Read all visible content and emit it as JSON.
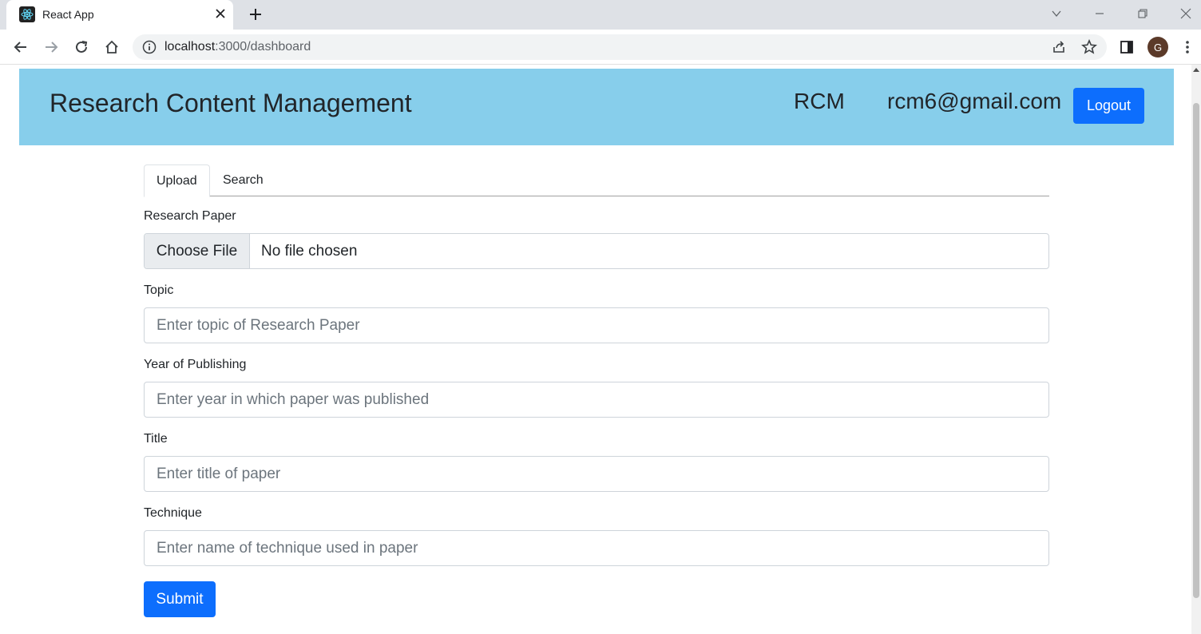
{
  "browser": {
    "tab_title": "React App",
    "url_host": "localhost",
    "url_path": ":3000/dashboard",
    "profile_initial": "G"
  },
  "header": {
    "brand": "Research Content Management",
    "short_name": "RCM",
    "email": "rcm6@gmail.com",
    "logout_label": "Logout",
    "background_color": "#87ceeb"
  },
  "tabs": [
    {
      "label": "Upload",
      "active": true
    },
    {
      "label": "Search",
      "active": false
    }
  ],
  "form": {
    "research_paper": {
      "label": "Research Paper",
      "button_label": "Choose File",
      "status": "No file chosen"
    },
    "topic": {
      "label": "Topic",
      "placeholder": "Enter topic of Research Paper",
      "value": ""
    },
    "year": {
      "label": "Year of Publishing",
      "placeholder": "Enter year in which paper was published",
      "value": ""
    },
    "title": {
      "label": "Title",
      "placeholder": "Enter title of paper",
      "value": ""
    },
    "technique": {
      "label": "Technique",
      "placeholder": "Enter name of technique used in paper",
      "value": ""
    },
    "submit_label": "Submit"
  },
  "colors": {
    "primary": "#0d6efd"
  }
}
